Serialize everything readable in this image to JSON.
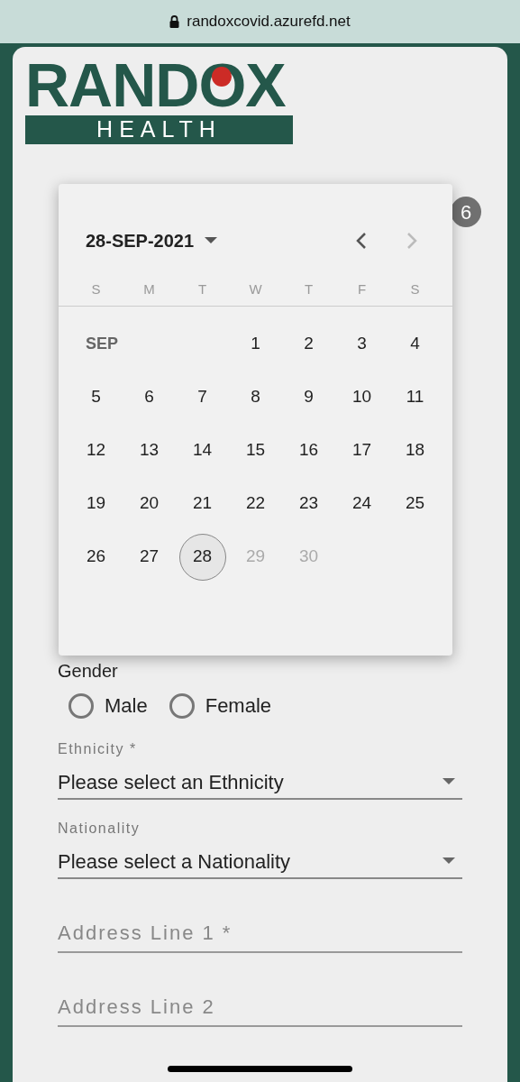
{
  "browser_bar": {
    "url": "randoxcovid.azurefd.net"
  },
  "logo": {
    "wordmark": "RANDOX",
    "band": "HEALTH"
  },
  "badge": "6",
  "datepicker": {
    "current_date": "28-SEP-2021",
    "weekdays": [
      "S",
      "M",
      "T",
      "W",
      "T",
      "F",
      "S"
    ],
    "month_label": "SEP",
    "days": [
      {
        "label": "1",
        "selected": false,
        "disabled": false
      },
      {
        "label": "2",
        "selected": false,
        "disabled": false
      },
      {
        "label": "3",
        "selected": false,
        "disabled": false
      },
      {
        "label": "4",
        "selected": false,
        "disabled": false
      },
      {
        "label": "5",
        "selected": false,
        "disabled": false
      },
      {
        "label": "6",
        "selected": false,
        "disabled": false
      },
      {
        "label": "7",
        "selected": false,
        "disabled": false
      },
      {
        "label": "8",
        "selected": false,
        "disabled": false
      },
      {
        "label": "9",
        "selected": false,
        "disabled": false
      },
      {
        "label": "10",
        "selected": false,
        "disabled": false
      },
      {
        "label": "11",
        "selected": false,
        "disabled": false
      },
      {
        "label": "12",
        "selected": false,
        "disabled": false
      },
      {
        "label": "13",
        "selected": false,
        "disabled": false
      },
      {
        "label": "14",
        "selected": false,
        "disabled": false
      },
      {
        "label": "15",
        "selected": false,
        "disabled": false
      },
      {
        "label": "16",
        "selected": false,
        "disabled": false
      },
      {
        "label": "17",
        "selected": false,
        "disabled": false
      },
      {
        "label": "18",
        "selected": false,
        "disabled": false
      },
      {
        "label": "19",
        "selected": false,
        "disabled": false
      },
      {
        "label": "20",
        "selected": false,
        "disabled": false
      },
      {
        "label": "21",
        "selected": false,
        "disabled": false
      },
      {
        "label": "22",
        "selected": false,
        "disabled": false
      },
      {
        "label": "23",
        "selected": false,
        "disabled": false
      },
      {
        "label": "24",
        "selected": false,
        "disabled": false
      },
      {
        "label": "25",
        "selected": false,
        "disabled": false
      },
      {
        "label": "26",
        "selected": false,
        "disabled": false
      },
      {
        "label": "27",
        "selected": false,
        "disabled": false
      },
      {
        "label": "28",
        "selected": true,
        "disabled": false
      },
      {
        "label": "29",
        "selected": false,
        "disabled": true
      },
      {
        "label": "30",
        "selected": false,
        "disabled": true
      }
    ],
    "next_disabled": true
  },
  "gender": {
    "label": "Gender",
    "options": [
      {
        "label": "Male",
        "selected": false
      },
      {
        "label": "Female",
        "selected": false
      }
    ]
  },
  "fields": [
    {
      "kind": "select",
      "label": "Ethnicity *",
      "value": "Please select an Ethnicity"
    },
    {
      "kind": "select",
      "label": "Nationality",
      "value": "Please select a Nationality"
    },
    {
      "kind": "text",
      "placeholder": "Address Line 1 *"
    },
    {
      "kind": "text",
      "placeholder": "Address Line 2"
    }
  ]
}
